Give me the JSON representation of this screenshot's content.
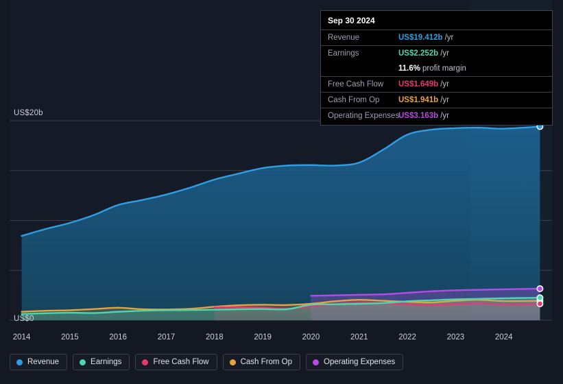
{
  "axes": {
    "y_top_label": "US$20b",
    "y_zero_label": "US$0"
  },
  "tooltip": {
    "date": "Sep 30 2024",
    "rows": [
      {
        "label": "Revenue",
        "value": "US$19.412b",
        "unit": "/yr",
        "color": "#2f9fe3"
      },
      {
        "label": "Earnings",
        "value": "US$2.252b",
        "unit": "/yr",
        "color": "#4cd7b0"
      },
      {
        "label": "",
        "value": "11.6%",
        "unit": "profit margin",
        "color": "#ffffff"
      },
      {
        "label": "Free Cash Flow",
        "value": "US$1.649b",
        "unit": "/yr",
        "color": "#e5396f"
      },
      {
        "label": "Cash From Op",
        "value": "US$1.941b",
        "unit": "/yr",
        "color": "#e8a33d"
      },
      {
        "label": "Operating Expenses",
        "value": "US$3.163b",
        "unit": "/yr",
        "color": "#b84ae8"
      }
    ]
  },
  "legend": {
    "items": [
      {
        "label": "Revenue",
        "color": "#2f9fe3"
      },
      {
        "label": "Earnings",
        "color": "#4cd7b0"
      },
      {
        "label": "Free Cash Flow",
        "color": "#e5396f"
      },
      {
        "label": "Cash From Op",
        "color": "#e8a33d"
      },
      {
        "label": "Operating Expenses",
        "color": "#b84ae8"
      }
    ]
  },
  "chart_data": {
    "type": "area",
    "title": "",
    "xlabel": "",
    "ylabel": "US$",
    "ylim": [
      0,
      20
    ],
    "y_ticks": [
      0,
      5,
      10,
      15,
      20
    ],
    "y_tick_labels": [
      "US$0",
      "",
      "",
      "",
      "US$20b"
    ],
    "grid": true,
    "legend_position": "bottom",
    "x_tick_labels": [
      "2014",
      "2015",
      "2016",
      "2017",
      "2018",
      "2019",
      "2020",
      "2021",
      "2022",
      "2023",
      "2024"
    ],
    "x": [
      2014.0,
      2014.5,
      2015.0,
      2015.5,
      2016.0,
      2016.5,
      2017.0,
      2017.5,
      2018.0,
      2018.5,
      2019.0,
      2019.5,
      2020.0,
      2020.5,
      2021.0,
      2021.5,
      2022.0,
      2022.5,
      2023.0,
      2023.5,
      2024.0,
      2024.75
    ],
    "series": [
      {
        "name": "Revenue",
        "color": "#2f9fe3",
        "units": "US$b",
        "values": [
          8.45,
          9.15,
          9.75,
          10.55,
          11.55,
          12.05,
          12.6,
          13.3,
          14.1,
          14.7,
          15.25,
          15.5,
          15.55,
          15.5,
          15.8,
          17.1,
          18.6,
          19.1,
          19.25,
          19.3,
          19.2,
          19.412
        ]
      },
      {
        "name": "Earnings",
        "color": "#4cd7b0",
        "units": "US$b",
        "values": [
          0.62,
          0.7,
          0.75,
          0.72,
          0.85,
          0.95,
          1.0,
          1.02,
          1.05,
          1.1,
          1.12,
          1.1,
          1.55,
          1.6,
          1.65,
          1.72,
          1.9,
          2.0,
          2.1,
          2.15,
          2.2,
          2.252
        ]
      },
      {
        "name": "Free Cash Flow",
        "color": "#e5396f",
        "units": "US$b",
        "values": [
          null,
          null,
          null,
          null,
          null,
          null,
          null,
          null,
          1.28,
          1.3,
          1.25,
          1.15,
          1.38,
          1.6,
          1.72,
          1.7,
          1.6,
          1.5,
          1.62,
          1.7,
          1.58,
          1.649
        ]
      },
      {
        "name": "Cash From Op",
        "color": "#e8a33d",
        "units": "US$b",
        "values": [
          0.85,
          0.95,
          1.0,
          1.12,
          1.25,
          1.1,
          1.08,
          1.15,
          1.35,
          1.5,
          1.55,
          1.52,
          1.65,
          1.9,
          2.05,
          1.95,
          1.85,
          1.78,
          1.95,
          2.05,
          1.92,
          1.941
        ]
      },
      {
        "name": "Operating Expenses",
        "color": "#b84ae8",
        "units": "US$b",
        "values": [
          null,
          null,
          null,
          null,
          null,
          null,
          null,
          null,
          null,
          null,
          null,
          null,
          2.45,
          2.5,
          2.55,
          2.6,
          2.75,
          2.9,
          3.0,
          3.05,
          3.1,
          3.163
        ]
      }
    ]
  }
}
